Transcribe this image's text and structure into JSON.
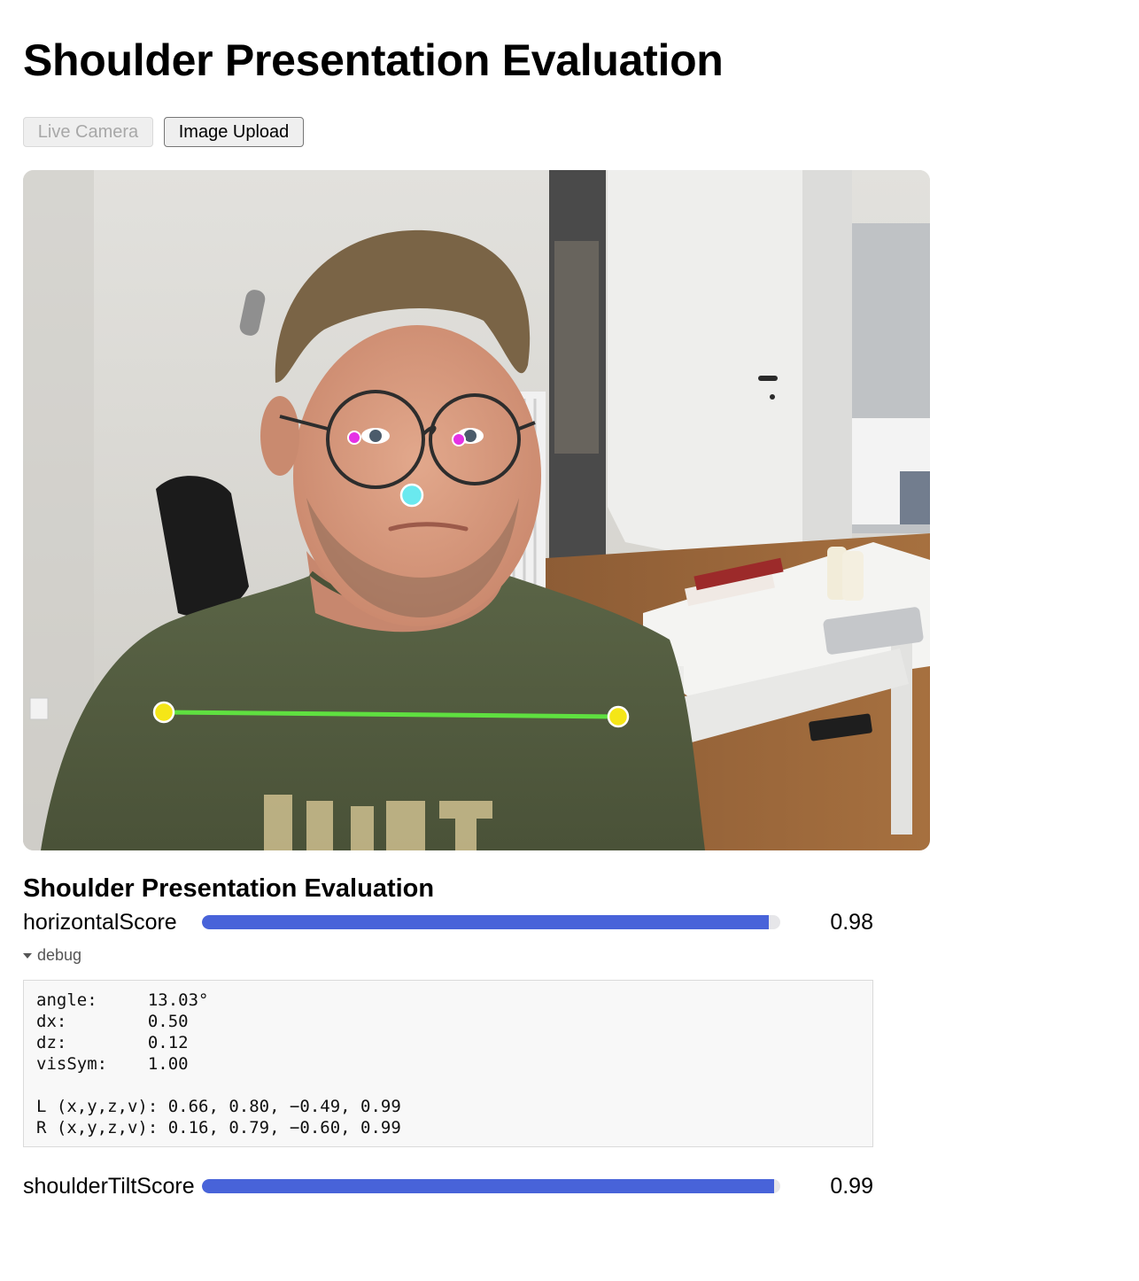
{
  "page": {
    "title": "Shoulder Presentation Evaluation"
  },
  "mode_buttons": {
    "live_camera": "Live Camera",
    "image_upload": "Image Upload"
  },
  "overlay": {
    "line_color": "#5fe040",
    "shoulder_color": "#f5e617",
    "eye_color": "#e531e5",
    "nose_color": "#6ae9ef"
  },
  "evaluation": {
    "title": "Shoulder Presentation Evaluation",
    "metrics": [
      {
        "label": "horizontalScore",
        "value_text": "0.98",
        "value": 0.98,
        "color": "#4863d9"
      },
      {
        "label": "shoulderTiltScore",
        "value_text": "0.99",
        "value": 0.99,
        "color": "#4863d9"
      }
    ],
    "debug": {
      "summary": "debug",
      "lines": [
        "angle:     13.03°",
        "dx:        0.50",
        "dz:        0.12",
        "visSym:    1.00",
        "",
        "L (x,y,z,v): 0.66, 0.80, −0.49, 0.99",
        "R (x,y,z,v): 0.16, 0.79, −0.60, 0.99"
      ]
    }
  }
}
